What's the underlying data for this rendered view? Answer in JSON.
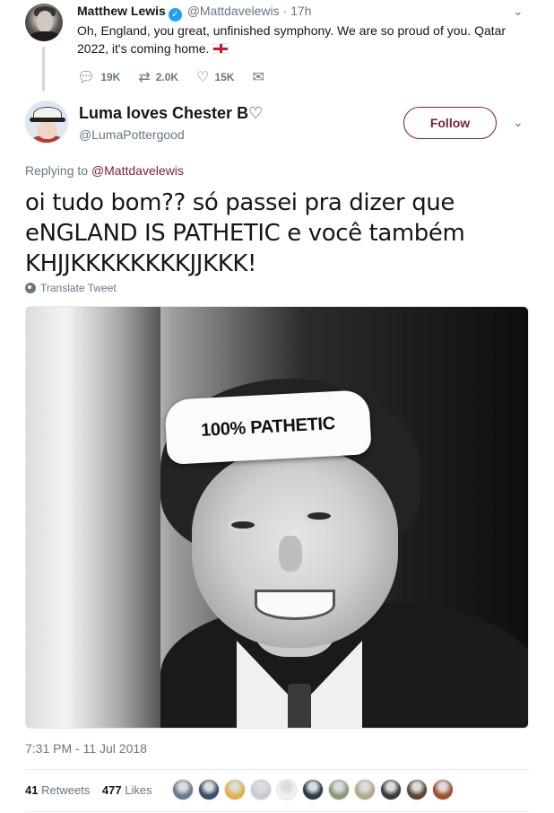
{
  "parent_tweet": {
    "author_name": "Matthew Lewis",
    "handle": "@Mattdavelewis",
    "separator": "·",
    "time": "17h",
    "text_line1": "Oh, England, you great, unfinished symphony. We are so proud of you. Qatar",
    "text_line2": "2022, it's coming home.",
    "replies": "19K",
    "retweets": "2.0K",
    "likes": "15K"
  },
  "main_tweet": {
    "author_name": "Luma loves Chester B♡",
    "handle": "@LumaPottergood",
    "follow_label": "Follow",
    "replying_prefix": "Replying to",
    "replying_to": "@Mattdavelewis",
    "text_lines": [
      "oi tudo bom?? só passei pra dizer que",
      "eNGLAND IS PATHETIC e você também",
      "KHJJKKKKKKKKJJKKK!"
    ],
    "translate_label": "Translate Tweet",
    "image_caption_text": "100% PATHETIC",
    "timestamp": "7:31 PM - 11 Jul 2018",
    "retweet_count": "41",
    "retweet_label": "Retweets",
    "like_count": "477",
    "like_label": "Likes"
  },
  "icons": {
    "verified": "verified-badge-icon",
    "reply": "reply-icon",
    "retweet": "retweet-icon",
    "like": "heart-icon",
    "dm": "envelope-icon",
    "menu": "chevron-down-icon",
    "translate": "globe-icon"
  },
  "colors": {
    "accent": "#7b1f3a",
    "verified": "#1da1f2",
    "muted": "#657786",
    "flag_red": "#cf142b"
  },
  "liker_avatar_colors": [
    "#6b7a8c",
    "#3a4d6b",
    "#e0b04a",
    "#c8ccd2",
    "#f1f1f1",
    "#2d3b47",
    "#8c9a7a",
    "#b7a88a",
    "#3b3b3b",
    "#5a4632",
    "#a0522d"
  ]
}
